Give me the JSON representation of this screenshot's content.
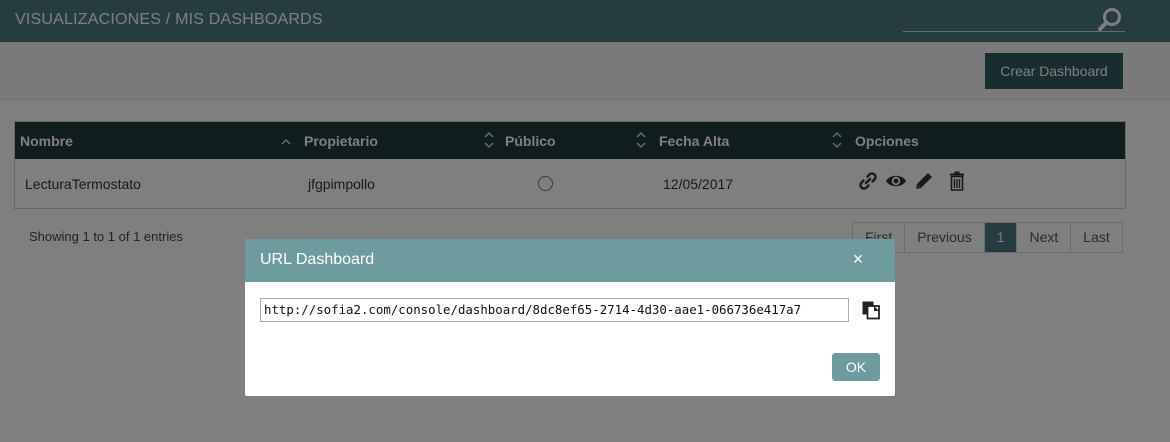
{
  "header": {
    "title": "VISUALIZACIONES / MIS DASHBOARDS",
    "search_icon": "search-icon"
  },
  "toolbar": {
    "create_label": "Crear Dashboard"
  },
  "table": {
    "columns": [
      "Nombre",
      "Propietario",
      "Público",
      "Fecha Alta",
      "Opciones"
    ],
    "rows": [
      {
        "nombre": "LecturaTermostato",
        "propietario": "jfgpimpollo",
        "publico": false,
        "fecha_alta": "12/05/2017",
        "options": [
          "link-icon",
          "view-icon",
          "edit-icon",
          "delete-icon"
        ]
      }
    ]
  },
  "footer": {
    "showing": "Showing 1 to 1 of 1 entries"
  },
  "pagination": {
    "first": "First",
    "previous": "Previous",
    "current": "1",
    "next": "Next",
    "last": "Last"
  },
  "modal": {
    "title": "URL Dashboard",
    "close": "×",
    "url": "http://sofia2.com/console/dashboard/8dc8ef65-2714-4d30-aae1-066736e417a7",
    "copy_icon": "copy-icon",
    "ok_label": "OK"
  },
  "colors": {
    "header_bg": "#4a7a80",
    "table_header_bg": "#1f3a3d",
    "modal_header_bg": "#6e9b9d",
    "button_dark": "#2f5b60"
  }
}
